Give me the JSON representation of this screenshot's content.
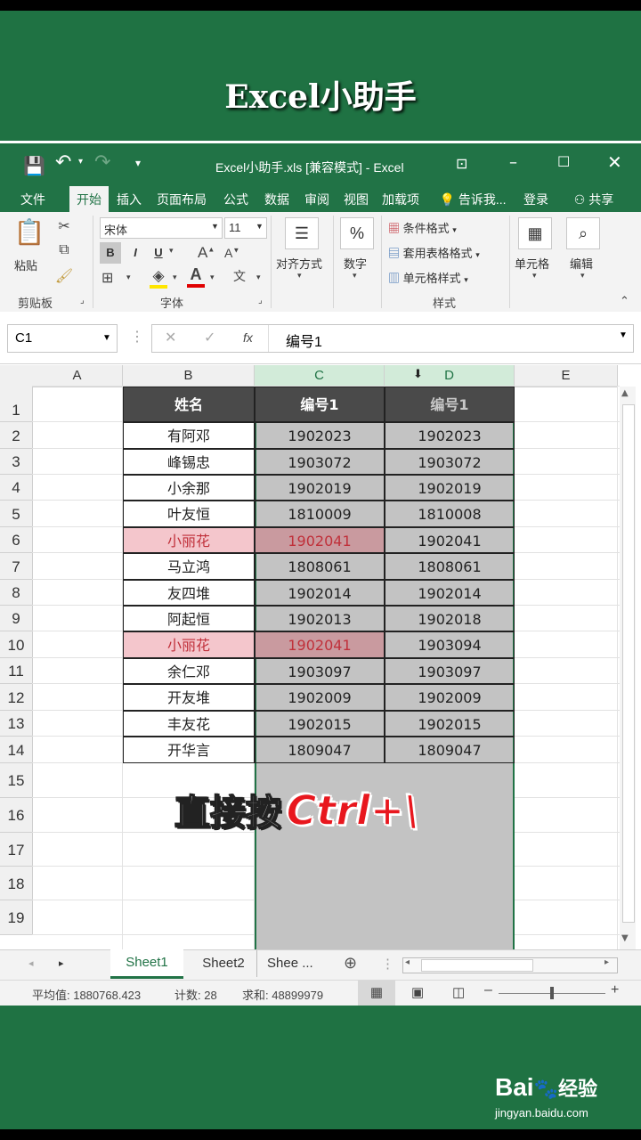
{
  "header": {
    "title": "Excel小助手"
  },
  "window": {
    "title": "Excel小助手.xls  [兼容模式] - Excel",
    "tabs": [
      "文件",
      "开始",
      "插入",
      "页面布局",
      "公式",
      "数据",
      "审阅",
      "视图",
      "加载项"
    ],
    "tell_me": "告诉我...",
    "login": "登录",
    "share": "共享"
  },
  "ribbon": {
    "paste": "粘贴",
    "clipboard": "剪贴板",
    "font_name": "宋体",
    "font_size": "11",
    "bold": "B",
    "italic": "I",
    "underline": "U",
    "font_group": "字体",
    "align": "对齐方式",
    "number": "数字",
    "cond_format": "条件格式",
    "table_format": "套用表格格式",
    "cell_style": "单元格样式",
    "style_group": "样式",
    "cells": "单元格",
    "edit": "编辑"
  },
  "formula": {
    "namebox": "C1",
    "fx": "fx",
    "content": "编号1"
  },
  "columns": [
    "A",
    "B",
    "C",
    "D",
    "E"
  ],
  "rows": [
    "1",
    "2",
    "3",
    "4",
    "5",
    "6",
    "7",
    "8",
    "9",
    "10",
    "11",
    "12",
    "13",
    "14",
    "15",
    "16",
    "17",
    "18",
    "19"
  ],
  "table": {
    "headers": [
      "姓名",
      "编号1",
      "编号1"
    ],
    "rows": [
      [
        "有阿邓",
        "1902023",
        "1902023"
      ],
      [
        "峰锡忠",
        "1903072",
        "1903072"
      ],
      [
        "小余那",
        "1902019",
        "1902019"
      ],
      [
        "叶友恒",
        "1810009",
        "1810008"
      ],
      [
        "小丽花",
        "1902041",
        "1902041"
      ],
      [
        "马立鸿",
        "1808061",
        "1808061"
      ],
      [
        "友四堆",
        "1902014",
        "1902014"
      ],
      [
        "阿起恒",
        "1902013",
        "1902018"
      ],
      [
        "小丽花",
        "1902041",
        "1903094"
      ],
      [
        "余仁邓",
        "1903097",
        "1903097"
      ],
      [
        "开友堆",
        "1902009",
        "1902009"
      ],
      [
        "丰友花",
        "1902015",
        "1902015"
      ],
      [
        "开华言",
        "1809047",
        "1809047"
      ]
    ],
    "highlight_rows": [
      4,
      8
    ]
  },
  "sheets": [
    "Sheet1",
    "Sheet2",
    "Shee ..."
  ],
  "status": {
    "avg": "平均值: 1880768.423",
    "count": "计数: 28",
    "sum": "求和: 48899979"
  },
  "overlay": {
    "text_a": "直接按",
    "text_b": "Ctrl+\\"
  },
  "watermark": {
    "brand": "Bai",
    "brand_cn": "经验",
    "url": "jingyan.baidu.com"
  },
  "colors": {
    "excel_green": "#217346",
    "header_dark": "#4a4a4a",
    "highlight_pink": "#f4c6cc",
    "highlight_text": "#c0303a",
    "selection_gray": "#c3c3c3"
  }
}
